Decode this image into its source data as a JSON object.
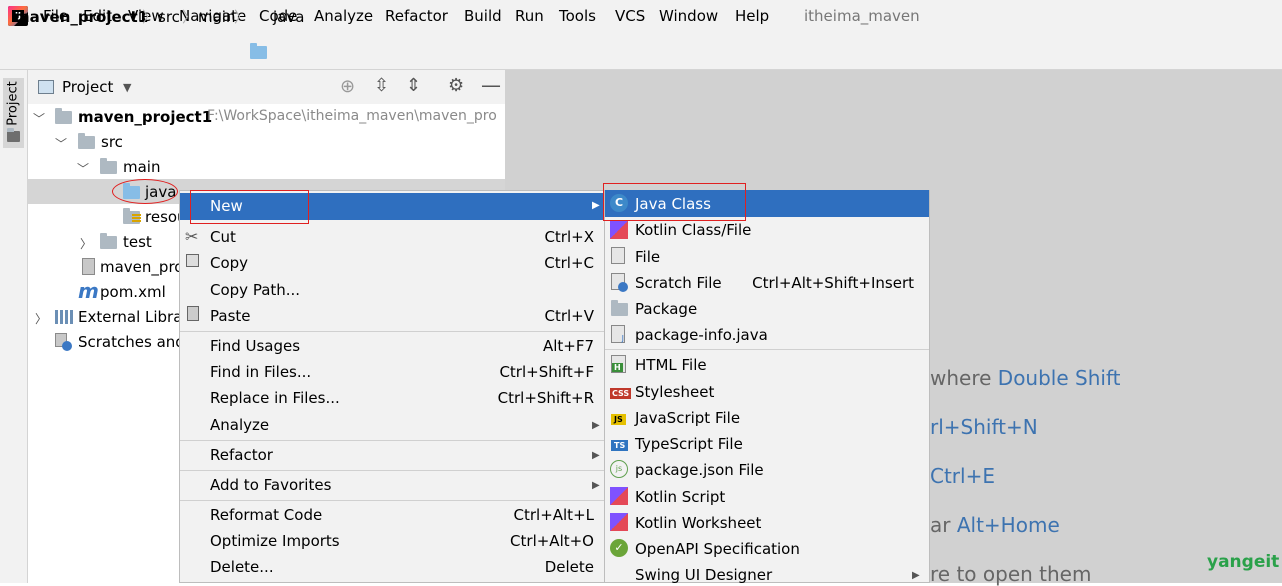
{
  "menubar": {
    "items": [
      "File",
      "Edit",
      "View",
      "Navigate",
      "Code",
      "Analyze",
      "Refactor",
      "Build",
      "Run",
      "Tools",
      "VCS",
      "Window",
      "Help"
    ],
    "window_title": "itheima_maven"
  },
  "breadcrumb": {
    "items": [
      "maven_project1",
      "src",
      "main",
      "java"
    ]
  },
  "stripe": {
    "project_label": "Project"
  },
  "project_panel": {
    "title": "Project",
    "tree": {
      "root_name": "maven_project1",
      "root_path": "F:\\WorkSpace\\itheima_maven\\maven_pro",
      "src": "src",
      "main": "main",
      "java": "java",
      "resources": "resou",
      "test": "test",
      "iml": "maven_pro",
      "pom": "pom.xml",
      "libs": "External Librar",
      "scratches": "Scratches and"
    }
  },
  "editor_hints": [
    "where Double Shift",
    "rl+Shift+N",
    "Ctrl+E",
    "ar Alt+Home",
    "re to open them"
  ],
  "hint_parts": {
    "h1a": "where ",
    "h1b": "Double Shift",
    "h2": "rl+Shift+N",
    "h3": "Ctrl+E",
    "h4a": "ar ",
    "h4b": "Alt+Home",
    "h5": "re to open them"
  },
  "watermark": "yangeit",
  "context_menu": {
    "new": "New",
    "items": [
      {
        "label": "Cut",
        "shortcut": "Ctrl+X"
      },
      {
        "label": "Copy",
        "shortcut": "Ctrl+C"
      },
      {
        "label": "Copy Path...",
        "shortcut": ""
      },
      {
        "label": "Paste",
        "shortcut": "Ctrl+V"
      },
      {
        "label": "Find Usages",
        "shortcut": "Alt+F7"
      },
      {
        "label": "Find in Files...",
        "shortcut": "Ctrl+Shift+F"
      },
      {
        "label": "Replace in Files...",
        "shortcut": "Ctrl+Shift+R"
      },
      {
        "label": "Analyze",
        "shortcut": ""
      },
      {
        "label": "Refactor",
        "shortcut": ""
      },
      {
        "label": "Add to Favorites",
        "shortcut": ""
      },
      {
        "label": "Reformat Code",
        "shortcut": "Ctrl+Alt+L"
      },
      {
        "label": "Optimize Imports",
        "shortcut": "Ctrl+Alt+O"
      },
      {
        "label": "Delete...",
        "shortcut": "Delete"
      }
    ]
  },
  "submenu": {
    "items": [
      {
        "label": "Java Class",
        "shortcut": ""
      },
      {
        "label": "Kotlin Class/File",
        "shortcut": ""
      },
      {
        "label": "File",
        "shortcut": ""
      },
      {
        "label": "Scratch File",
        "shortcut": "Ctrl+Alt+Shift+Insert"
      },
      {
        "label": "Package",
        "shortcut": ""
      },
      {
        "label": "package-info.java",
        "shortcut": ""
      },
      {
        "label": "HTML File",
        "shortcut": ""
      },
      {
        "label": "Stylesheet",
        "shortcut": ""
      },
      {
        "label": "JavaScript File",
        "shortcut": ""
      },
      {
        "label": "TypeScript File",
        "shortcut": ""
      },
      {
        "label": "package.json File",
        "shortcut": ""
      },
      {
        "label": "Kotlin Script",
        "shortcut": ""
      },
      {
        "label": "Kotlin Worksheet",
        "shortcut": ""
      },
      {
        "label": "OpenAPI Specification",
        "shortcut": ""
      },
      {
        "label": "Swing UI Designer",
        "shortcut": ""
      }
    ]
  },
  "colors": {
    "selection_blue": "#2f6fbf",
    "highlight_red": "#e02020",
    "link_blue": "#3d73b0"
  }
}
